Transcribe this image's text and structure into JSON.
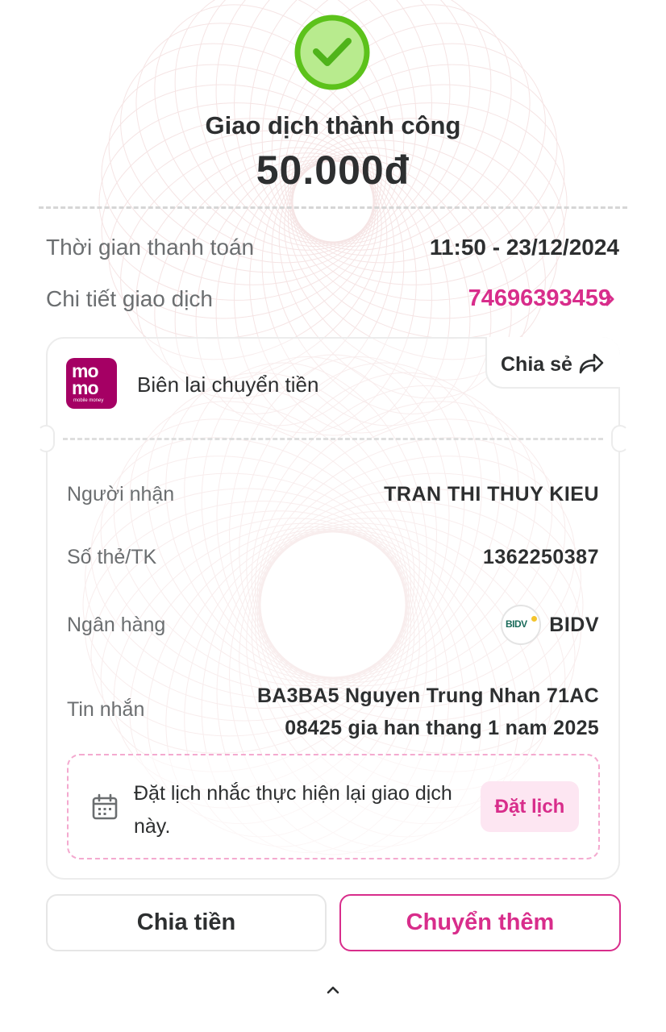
{
  "status": {
    "title": "Giao dịch thành công",
    "amount": "50.000đ"
  },
  "summary": {
    "payment_time_label": "Thời gian thanh toán",
    "payment_time_value": "11:50 - 23/12/2024",
    "detail_label": "Chi tiết giao dịch",
    "transaction_id": "74696393459"
  },
  "receipt": {
    "logo_line1": "mo",
    "logo_line2": "mo",
    "logo_tagline": "mobile money",
    "title": "Biên lai chuyển tiền",
    "share_label": "Chia sẻ",
    "rows": {
      "recipient_label": "Người nhận",
      "recipient_value": "TRAN THI THUY KIEU",
      "account_label": "Số thẻ/TK",
      "account_value": "1362250387",
      "bank_label": "Ngân hàng",
      "bank_logo_text": "BIDV",
      "bank_value": "BIDV",
      "message_label": "Tin nhắn",
      "message_value": "BA3BA5 Nguyen Trung Nhan 71AC 08425 gia han thang 1 nam 2025"
    },
    "reminder": {
      "text": "Đặt lịch nhắc thực hiện lại giao dịch này.",
      "button_label": "Đặt lịch"
    }
  },
  "actions": {
    "split_label": "Chia tiền",
    "transfer_more_label": "Chuyển thêm"
  },
  "colors": {
    "brand_pink": "#d82d8b",
    "success_green": "#5cc21b",
    "momo_purple": "#a50064"
  },
  "icons": [
    "check-circle-icon",
    "chevron-right-icon",
    "share-arrow-icon",
    "calendar-icon",
    "chevron-up-icon"
  ]
}
